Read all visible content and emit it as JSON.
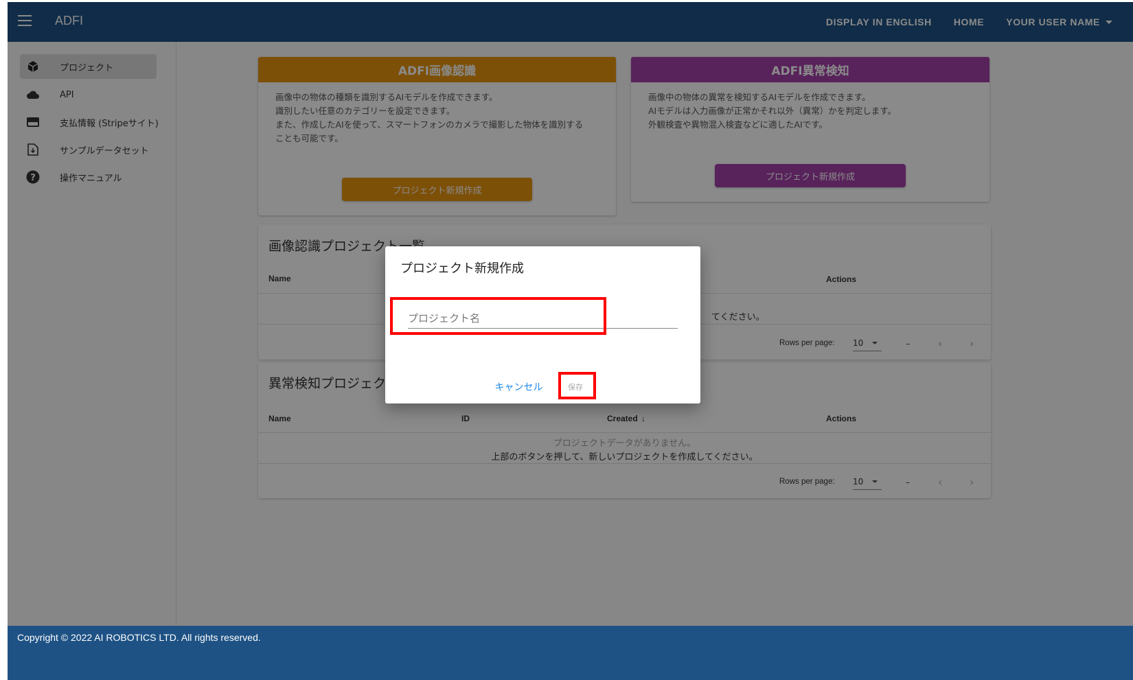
{
  "header": {
    "app_title": "ADFI",
    "nav_english": "DISPLAY IN ENGLISH",
    "nav_home": "HOME",
    "nav_user": "YOUR USER NAME"
  },
  "sidebar": {
    "items": [
      {
        "label": "プロジェクト",
        "icon": "cube-icon",
        "active": true
      },
      {
        "label": "API",
        "icon": "cloud-icon"
      },
      {
        "label": "支払情報 (Stripeサイト)",
        "icon": "credit-card-icon"
      },
      {
        "label": "サンプルデータセット",
        "icon": "file-download-icon"
      },
      {
        "label": "操作マニュアル",
        "icon": "help-circle-icon"
      }
    ]
  },
  "cards": {
    "image_recognition": {
      "title": "ADFI画像認識",
      "color": "#e8950f",
      "lines": [
        "画像中の物体の種類を識別するAIモデルを作成できます。",
        "識別したい任意のカテゴリーを設定できます。",
        "また、作成したAIを使って、スマートフォンのカメラで撮影した物体を識別する",
        "ことも可能です。"
      ],
      "button": "プロジェクト新規作成"
    },
    "anomaly_detection": {
      "title": "ADFI異常検知",
      "color": "#a33fa8",
      "lines": [
        "画像中の物体の異常を検知するAIモデルを作成できます。",
        "AIモデルは入力画像が正常かそれ以外（異常）かを判定します。",
        "外観検査や異物混入検査などに適したAIです。"
      ],
      "button": "プロジェクト新規作成"
    }
  },
  "lists": {
    "image_recognition": {
      "title": "画像認識プロジェクト一覧",
      "columns": {
        "name": "Name",
        "actions": "Actions"
      },
      "empty_line2_visible": "てください。",
      "rows_per_page_label": "Rows per page:",
      "rows_per_page": "10",
      "range": "–"
    },
    "anomaly_detection": {
      "title": "異常検知プロジェクト一覧",
      "columns": {
        "name": "Name",
        "id": "ID",
        "created": "Created",
        "actions": "Actions"
      },
      "empty_line1": "プロジェクトデータがありません。",
      "empty_line2": "上部のボタンを押して、新しいプロジェクトを作成してください。",
      "rows_per_page_label": "Rows per page:",
      "rows_per_page": "10",
      "range": "–"
    }
  },
  "dialog": {
    "title": "プロジェクト新規作成",
    "name_placeholder": "プロジェクト名",
    "name_value": "",
    "cancel": "キャンセル",
    "save": "保存"
  },
  "footer": {
    "copyright": "Copyright © 2022 AI ROBOTICS LTD. All rights reserved."
  },
  "colors": {
    "primary": "#1e5285",
    "highlight": "#ff0000",
    "link": "#1e88e5"
  }
}
